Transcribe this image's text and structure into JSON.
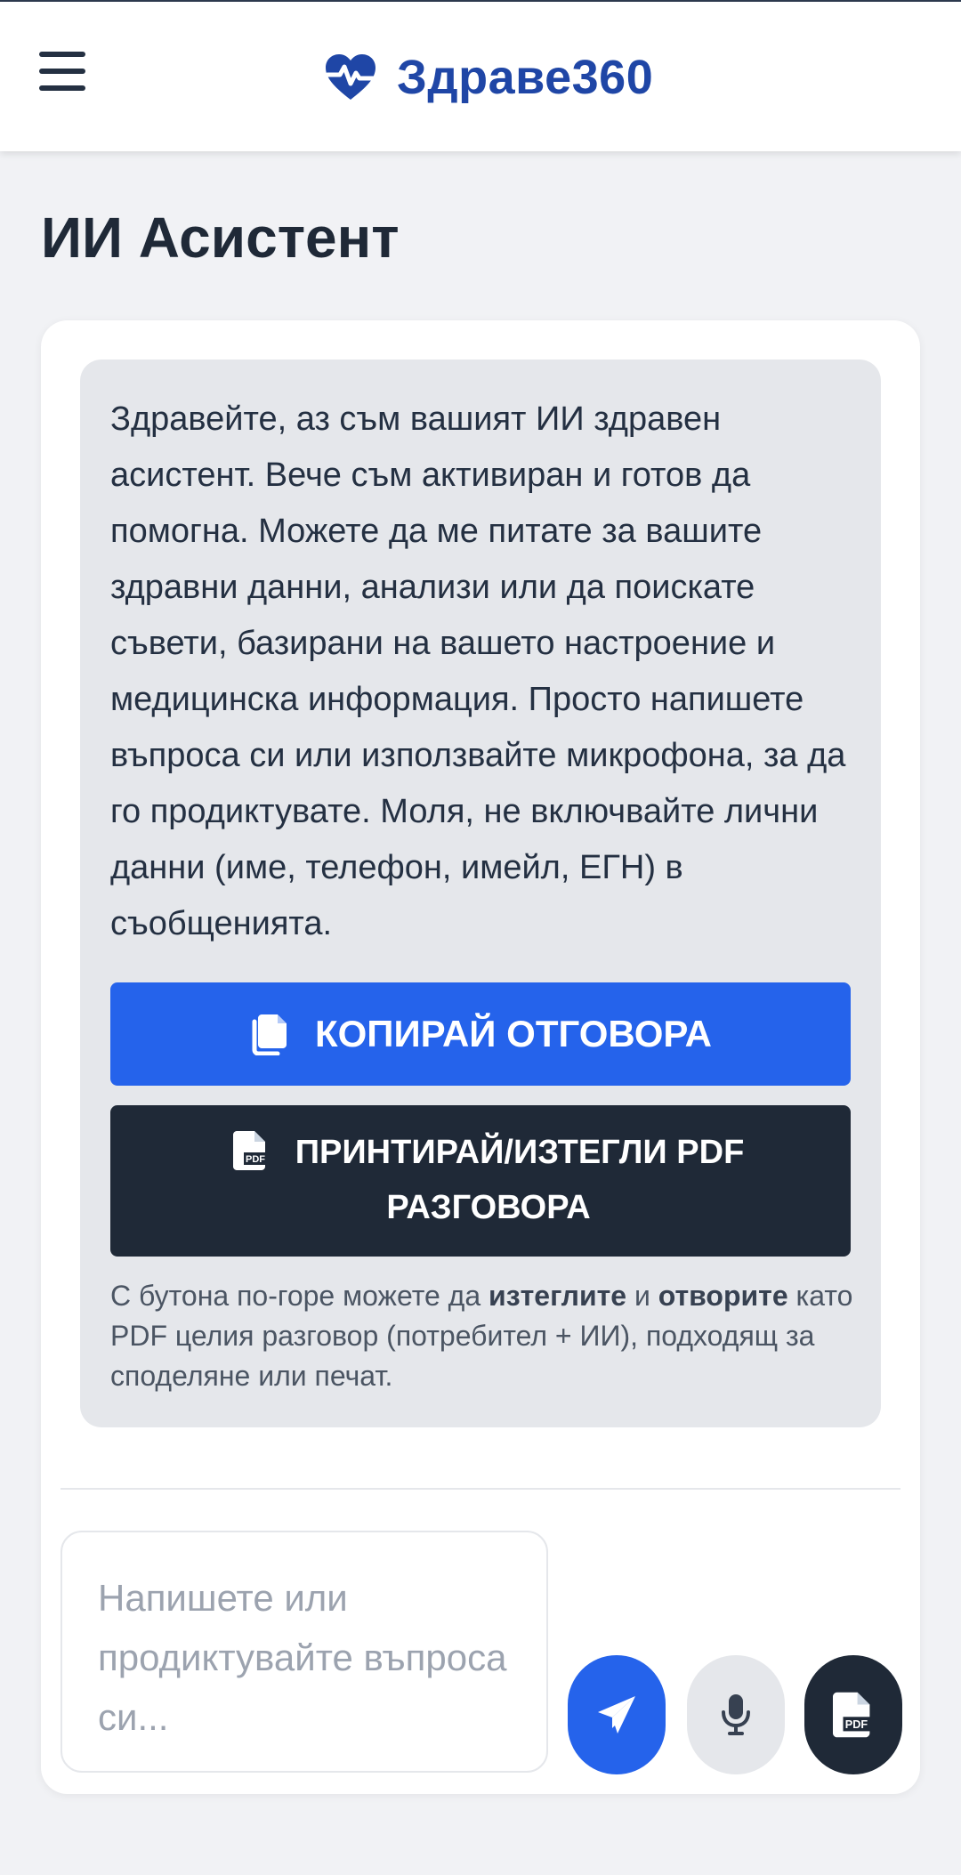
{
  "header": {
    "brand_name": "Здраве360",
    "brand_icon": "heart-pulse-icon",
    "menu_icon": "menu-icon",
    "brand_color": "#1f46a6"
  },
  "page": {
    "title": "ИИ Асистент"
  },
  "chat": {
    "assistant_message": "Здравейте, аз съм вашият ИИ здравен асистент. Вече съм активиран и готов да помогна. Можете да ме питате за вашите здравни данни, анализи или да поискате съвети, базирани на вашето настроение и медицинска информация. Просто напишете въпроса си или използвайте микрофона, за да го продиктувате. Моля, не включвайте лични данни (име, телефон, имейл, ЕГН) в съобщенията.",
    "copy_button_label": "КОПИРАЙ ОТГОВОРА",
    "copy_icon": "copy-icon",
    "pdf_button_label": "ПРИНТИРАЙ/ИЗТЕГЛИ PDF РАЗГОВОРА",
    "pdf_icon": "file-pdf-icon",
    "note": {
      "part1": "С бутона по-горе можете да ",
      "bold1": "изтеглите",
      "part2": " и ",
      "bold2": "отворите",
      "part3": " като PDF целия разговор (потребител + ИИ), подходящ за споделяне или печат."
    }
  },
  "composer": {
    "placeholder": "Напишете или продиктувайте въпроса си...",
    "value": "",
    "send_icon": "paper-plane-icon",
    "mic_icon": "microphone-icon",
    "pdf_icon": "file-pdf-icon"
  },
  "colors": {
    "primary": "#2563eb",
    "dark": "#1f2937",
    "bubble": "#e5e7eb",
    "background": "#f1f2f5"
  }
}
